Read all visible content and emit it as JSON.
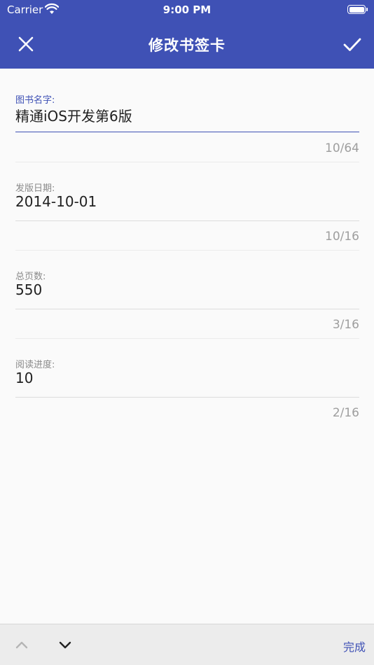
{
  "status_bar": {
    "carrier": "Carrier",
    "time": "9:00 PM",
    "wifi_icon": "wifi-icon",
    "battery_icon": "battery-icon"
  },
  "app_bar": {
    "title": "修改书签卡",
    "close_icon": "close-icon",
    "confirm_icon": "check-icon",
    "color": "#3f51b5"
  },
  "form": {
    "fields": [
      {
        "label": "图书名字:",
        "value": "精通iOS开发第6版",
        "counter": "10/64",
        "active": true
      },
      {
        "label": "发版日期:",
        "value": "2014-10-01",
        "counter": "10/16",
        "active": false
      },
      {
        "label": "总页数:",
        "value": "550",
        "counter": "3/16",
        "active": false
      },
      {
        "label": "阅读进度:",
        "value": "10",
        "counter": "2/16",
        "active": false
      }
    ]
  },
  "keyboard_accessory": {
    "prev_icon": "chevron-up-icon",
    "next_icon": "chevron-down-icon",
    "done_label": "完成"
  }
}
